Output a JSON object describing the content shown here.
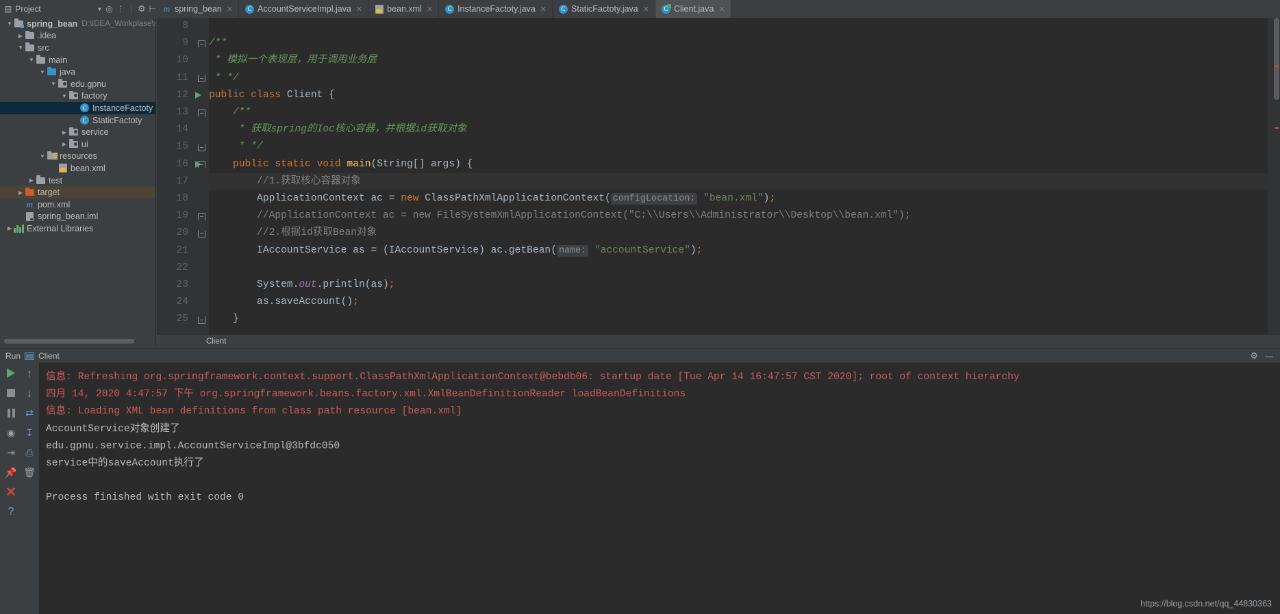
{
  "window": {
    "project_panel_title": "Project",
    "breadcrumb": "Client",
    "watermark": "https://blog.csdn.net/qq_44830363"
  },
  "project_toolbar": {
    "icons": [
      "project-view-icon",
      "chevron-down-icon",
      "locate-icon",
      "collapse-all-icon",
      "settings-gear-icon",
      "hide-icon"
    ]
  },
  "tabs": [
    {
      "label": "spring_bean",
      "icon": "maven-module-icon",
      "active": false,
      "closeable": true
    },
    {
      "label": "AccountServiceImpl.java",
      "icon": "java-class-icon",
      "active": false,
      "closeable": true
    },
    {
      "label": "bean.xml",
      "icon": "xml-file-icon",
      "active": false,
      "closeable": true
    },
    {
      "label": "InstanceFactoty.java",
      "icon": "java-class-icon",
      "active": false,
      "closeable": true
    },
    {
      "label": "StaticFactoty.java",
      "icon": "java-class-icon",
      "active": false,
      "closeable": true
    },
    {
      "label": "Client.java",
      "icon": "java-runnable-class-icon",
      "active": true,
      "closeable": true
    }
  ],
  "sidebar": {
    "tree": [
      {
        "label": "spring_bean",
        "path": "D:\\IDEA_Workplase\\sprin",
        "indent": 0,
        "arrow": "down",
        "icon": "module-folder-icon",
        "bold": true,
        "state": "normal"
      },
      {
        "label": ".idea",
        "indent": 1,
        "arrow": "right",
        "icon": "folder-icon",
        "state": "normal"
      },
      {
        "label": "src",
        "indent": 1,
        "arrow": "down",
        "icon": "folder-icon",
        "state": "normal"
      },
      {
        "label": "main",
        "indent": 2,
        "arrow": "down",
        "icon": "folder-icon",
        "state": "normal"
      },
      {
        "label": "java",
        "indent": 3,
        "arrow": "down",
        "icon": "source-root-folder-icon",
        "state": "normal"
      },
      {
        "label": "edu.gpnu",
        "indent": 4,
        "arrow": "down",
        "icon": "package-icon",
        "state": "normal"
      },
      {
        "label": "factory",
        "indent": 5,
        "arrow": "down",
        "icon": "package-icon",
        "state": "normal"
      },
      {
        "label": "InstanceFactoty",
        "indent": 6,
        "arrow": "none",
        "icon": "java-class-icon",
        "state": "selected"
      },
      {
        "label": "StaticFactoty",
        "indent": 6,
        "arrow": "none",
        "icon": "java-class-icon",
        "state": "normal"
      },
      {
        "label": "service",
        "indent": 5,
        "arrow": "right",
        "icon": "package-icon",
        "state": "normal"
      },
      {
        "label": "ui",
        "indent": 5,
        "arrow": "right",
        "icon": "package-icon",
        "state": "normal"
      },
      {
        "label": "resources",
        "indent": 3,
        "arrow": "down",
        "icon": "resource-root-folder-icon",
        "state": "normal"
      },
      {
        "label": "bean.xml",
        "indent": 4,
        "arrow": "none",
        "icon": "xml-file-icon",
        "state": "normal"
      },
      {
        "label": "test",
        "indent": 2,
        "arrow": "right",
        "icon": "folder-icon",
        "state": "normal"
      },
      {
        "label": "target",
        "indent": 1,
        "arrow": "right",
        "icon": "excluded-folder-icon",
        "state": "highlighted"
      },
      {
        "label": "pom.xml",
        "indent": 1,
        "arrow": "none",
        "icon": "maven-pom-icon",
        "state": "normal"
      },
      {
        "label": "spring_bean.iml",
        "indent": 1,
        "arrow": "none",
        "icon": "iml-file-icon",
        "state": "normal"
      },
      {
        "label": "External Libraries",
        "indent": 0,
        "arrow": "right",
        "icon": "external-libraries-icon",
        "state": "normal"
      }
    ]
  },
  "editor": {
    "first_visible_line": 8,
    "lines": [
      {
        "num": 8,
        "tokens": []
      },
      {
        "num": 9,
        "fold": "top",
        "tokens": [
          {
            "t": "/**",
            "c": "jdoc",
            "indent": 0
          }
        ]
      },
      {
        "num": 10,
        "tokens": [
          {
            "t": " * 模拟一个表现层，用于调用业务层",
            "c": "jdoc"
          }
        ]
      },
      {
        "num": 11,
        "fold": "bot",
        "tokens": [
          {
            "t": " * */",
            "c": "jdoc"
          }
        ]
      },
      {
        "num": 12,
        "runmark": true,
        "tokens": [
          {
            "t": "public class ",
            "c": "kw"
          },
          {
            "t": "Client ",
            "c": "pun"
          },
          {
            "t": "{",
            "c": "pun"
          }
        ]
      },
      {
        "num": 13,
        "fold": "top",
        "tokens": [
          {
            "t": "    /**",
            "c": "jdoc"
          }
        ]
      },
      {
        "num": 14,
        "tokens": [
          {
            "t": "     * 获取spring的Ioc核心容器，并根据id获取对象",
            "c": "jdoc"
          }
        ]
      },
      {
        "num": 15,
        "fold": "bot",
        "tokens": [
          {
            "t": "     * */",
            "c": "jdoc"
          }
        ]
      },
      {
        "num": 16,
        "runmark": true,
        "fold": "top",
        "tokens": [
          {
            "t": "    ",
            "c": "pun"
          },
          {
            "t": "public static void ",
            "c": "kw"
          },
          {
            "t": "main",
            "c": "fn"
          },
          {
            "t": "(String[] args) {",
            "c": "pun"
          }
        ]
      },
      {
        "num": 17,
        "hl": true,
        "tokens": [
          {
            "t": "        //1.获取核心容器对象",
            "c": "cmt"
          }
        ]
      },
      {
        "num": 18,
        "tokens": [
          {
            "t": "        ApplicationContext ac = ",
            "c": "pun"
          },
          {
            "t": "new ",
            "c": "kw"
          },
          {
            "t": "ClassPathXmlApplicationContext(",
            "c": "pun"
          },
          {
            "t": "configLocation:",
            "c": "hint"
          },
          {
            "t": " ",
            "c": "pun"
          },
          {
            "t": "\"bean.xml\"",
            "c": "str"
          },
          {
            "t": ")",
            "c": "pun"
          },
          {
            "t": ";",
            "c": "sem"
          }
        ]
      },
      {
        "num": 19,
        "fold": "top",
        "tokens": [
          {
            "t": "        //ApplicationContext ac = new FileSystemXmlApplicationContext(\"C:\\\\Users\\\\Administrator\\\\Desktop\\\\bean.xml\");",
            "c": "cmt"
          }
        ]
      },
      {
        "num": 20,
        "fold": "bot",
        "tokens": [
          {
            "t": "        //2.根据id获取Bean对象",
            "c": "cmt"
          }
        ]
      },
      {
        "num": 21,
        "tokens": [
          {
            "t": "        IAccountService as = (IAccountService) ac.getBean(",
            "c": "pun"
          },
          {
            "t": "name:",
            "c": "hint"
          },
          {
            "t": " ",
            "c": "pun"
          },
          {
            "t": "\"accountService\"",
            "c": "str"
          },
          {
            "t": ")",
            "c": "pun"
          },
          {
            "t": ";",
            "c": "sem"
          }
        ]
      },
      {
        "num": 22,
        "tokens": []
      },
      {
        "num": 23,
        "tokens": [
          {
            "t": "        System.",
            "c": "pun"
          },
          {
            "t": "out",
            "c": "stat"
          },
          {
            "t": ".println(as)",
            "c": "pun"
          },
          {
            "t": ";",
            "c": "sem"
          }
        ]
      },
      {
        "num": 24,
        "tokens": [
          {
            "t": "        as.saveAccount()",
            "c": "pun"
          },
          {
            "t": ";",
            "c": "sem"
          }
        ]
      },
      {
        "num": 25,
        "fold": "bot",
        "tokens": [
          {
            "t": "    }",
            "c": "pun"
          }
        ]
      }
    ]
  },
  "run_panel": {
    "title": "Run",
    "config_name": "Client",
    "toolbar_icons_col1": [
      "rerun-icon",
      "stop-icon",
      "pause-icon",
      "dump-threads-icon",
      "exit-icon",
      "pin-tab-icon",
      "close-icon",
      "help-icon"
    ],
    "toolbar_icons_col2": [
      "up-stack-icon",
      "down-stack-icon",
      "soft-wrap-icon",
      "scroll-to-end-icon",
      "print-icon",
      "clear-all-icon"
    ],
    "header_right_icons": [
      "settings-gear-icon",
      "hide-panel-icon"
    ],
    "console_lines": [
      {
        "text": "信息: Refreshing org.springframework.context.support.ClassPathXmlApplicationContext@bebdb06: startup date [Tue Apr 14 16:47:57 CST 2020]; root of context hierarchy",
        "style": "red"
      },
      {
        "text": "四月 14, 2020 4:47:57 下午 org.springframework.beans.factory.xml.XmlBeanDefinitionReader loadBeanDefinitions",
        "style": "red"
      },
      {
        "text": "信息: Loading XML bean definitions from class path resource [bean.xml]",
        "style": "red"
      },
      {
        "text": "AccountService对象创建了",
        "style": "normal"
      },
      {
        "text": "edu.gpnu.service.impl.AccountServiceImpl@3bfdc050",
        "style": "normal"
      },
      {
        "text": "service中的saveAccount执行了",
        "style": "normal"
      },
      {
        "text": "",
        "style": "normal"
      },
      {
        "text": "Process finished with exit code 0",
        "style": "normal"
      }
    ]
  },
  "colors": {
    "accent": "#3592c4",
    "run_green": "#59a869",
    "error_red": "#cf5b56",
    "selection": "#0d293e",
    "editor_bg": "#2b2b2b",
    "panel_bg": "#3c3f41"
  }
}
